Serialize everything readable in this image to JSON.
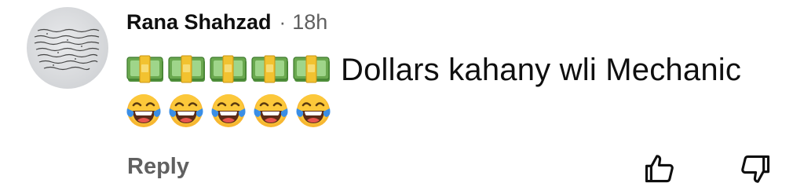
{
  "comment": {
    "author": "Rana Shahzad",
    "separator": "·",
    "time": "18h",
    "text": "Dollars kahany wli Mechanic",
    "money_emoji_count": 5,
    "laugh_emoji_count": 5
  },
  "actions": {
    "reply_label": "Reply",
    "like_icon": "thumbs-up-icon",
    "dislike_icon": "thumbs-down-icon"
  },
  "icons": {
    "money": "money-with-wings-icon",
    "laugh": "tears-of-joy-icon"
  },
  "colors": {
    "author": "#0f0f0f",
    "meta": "#606060",
    "money_green": "#6aa84f",
    "money_band": "#f2c230",
    "emoji_yellow": "#f7b731",
    "emoji_tears": "#3a8ee6"
  }
}
